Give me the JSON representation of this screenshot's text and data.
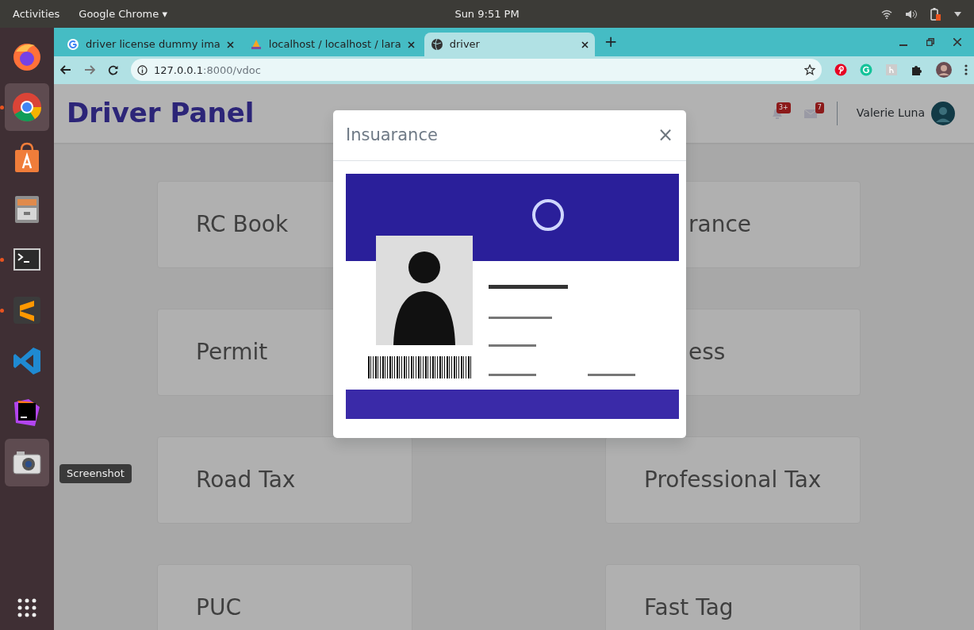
{
  "top_bar": {
    "activities": "Activities",
    "app_menu": "Google Chrome ▾",
    "clock": "Sun 9:51 PM"
  },
  "dock": [
    {
      "kind": "firefox",
      "running": false,
      "highlighted": false
    },
    {
      "kind": "chrome",
      "running": true,
      "highlighted": true
    },
    {
      "kind": "store",
      "running": false,
      "highlighted": false
    },
    {
      "kind": "files",
      "running": false,
      "highlighted": false
    },
    {
      "kind": "terminal",
      "running": true,
      "highlighted": false
    },
    {
      "kind": "sublime",
      "running": true,
      "highlighted": false
    },
    {
      "kind": "vscode",
      "running": false,
      "highlighted": false
    },
    {
      "kind": "intellij",
      "running": false,
      "highlighted": false
    },
    {
      "kind": "camera",
      "running": false,
      "highlighted": true
    }
  ],
  "dock_tooltip": "Screenshot",
  "browser": {
    "tabs": [
      {
        "kind": "google",
        "title": "driver license dummy ima",
        "selected": false
      },
      {
        "kind": "pma",
        "title": "localhost / localhost / lara",
        "selected": false
      },
      {
        "kind": "globe",
        "title": "driver",
        "selected": true
      }
    ],
    "new_tab": "+",
    "url_host": "127.0.0.1",
    "url_rest": ":8000/vdoc"
  },
  "header": {
    "title": "Driver Panel",
    "notifications_badge": "3+",
    "messages_badge": "7",
    "user_name": "Valerie Luna"
  },
  "cards": [
    {
      "label": "RC Book",
      "covered": false
    },
    {
      "label": "rance",
      "covered": true
    },
    {
      "label": "Permit",
      "covered": false
    },
    {
      "label": "ess",
      "covered": true
    },
    {
      "label": "Road Tax",
      "covered": false
    },
    {
      "label": "Professional Tax",
      "covered": false
    },
    {
      "label": "PUC",
      "covered": false
    },
    {
      "label": "Fast Tag",
      "covered": false
    }
  ],
  "modal": {
    "title": "Insuarance",
    "close": "×"
  }
}
